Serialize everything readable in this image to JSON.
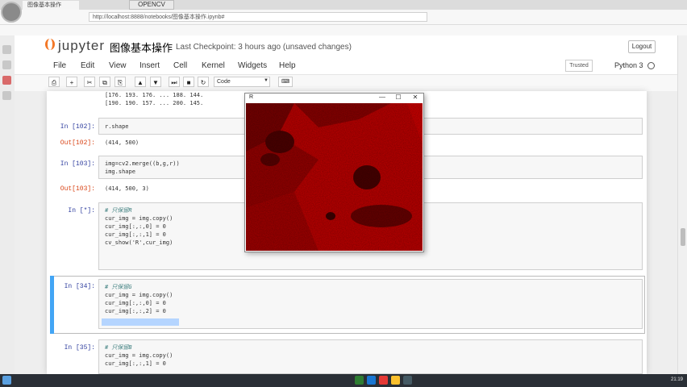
{
  "browser": {
    "tab_title": "图像基本操作",
    "tab_tag": "OPENCV",
    "url": "http://localhost:8888/notebooks/图像基本操作.ipynb#",
    "bookmarks": []
  },
  "jupyter": {
    "logo_text": "jupyter",
    "notebook_name": "图像基本操作",
    "checkpoint": "Last Checkpoint: 3 hours ago (unsaved changes)",
    "logout_label": "Logout",
    "menu": [
      "File",
      "Edit",
      "View",
      "Insert",
      "Cell",
      "Kernel",
      "Widgets",
      "Help"
    ],
    "trusted_label": "Trusted",
    "kernel_name": "Python 3",
    "cell_type": "Code"
  },
  "toolbar": {
    "save": "⎙",
    "add": "+",
    "cut": "✂",
    "copy": "⧉",
    "paste": "⎘",
    "up": "▲",
    "down": "▼",
    "run": "⏭",
    "stop": "■",
    "restart": "↻",
    "keyboard": "⌨"
  },
  "cells": {
    "out_prev": {
      "line1": "[176. 193. 176. ... 188. 144.",
      "line2": "[190. 190. 157. ... 200. 145."
    },
    "c102": {
      "prompt_in": "In [102]:",
      "code": "r.shape",
      "prompt_out": "Out[102]:",
      "output": "(414, 500)"
    },
    "c103": {
      "prompt_in": "In [103]:",
      "code1": "img=cv2.merge((b,g,r))",
      "code2": "img.shape",
      "prompt_out": "Out[103]:",
      "output": "(414, 500, 3)"
    },
    "c_star": {
      "prompt_in": "In [*]:",
      "comment": "# 只保留R",
      "code1": "cur_img = img.copy()",
      "code2": "cur_img[:,:,0] = 0",
      "code3": "cur_img[:,:,1] = 0",
      "code4": "cv_show('R',cur_img)"
    },
    "c34": {
      "prompt_in": "In [34]:",
      "comment": "# 只保留G",
      "code1": "cur_img = img.copy()",
      "code2": "cur_img[:,:,0] = 0",
      "code3": "cur_img[:,:,2] = 0"
    },
    "c35": {
      "prompt_in": "In [35]:",
      "comment": "# 只保留B",
      "code1": "cur_img = img.copy()",
      "code2": "cur_img[:,:,1] = 0"
    }
  },
  "image_window": {
    "title": "R",
    "minimize": "—",
    "maximize": "☐",
    "close": "✕"
  },
  "taskbar": {
    "clock": "21:19"
  },
  "colors": {
    "accent_orange": "#f37726",
    "in_prompt": "#303f9f",
    "out_prompt": "#d84315",
    "selected_cell_bar": "#42a5f5",
    "image_red": "#c00000",
    "image_dark": "#5a0000"
  }
}
